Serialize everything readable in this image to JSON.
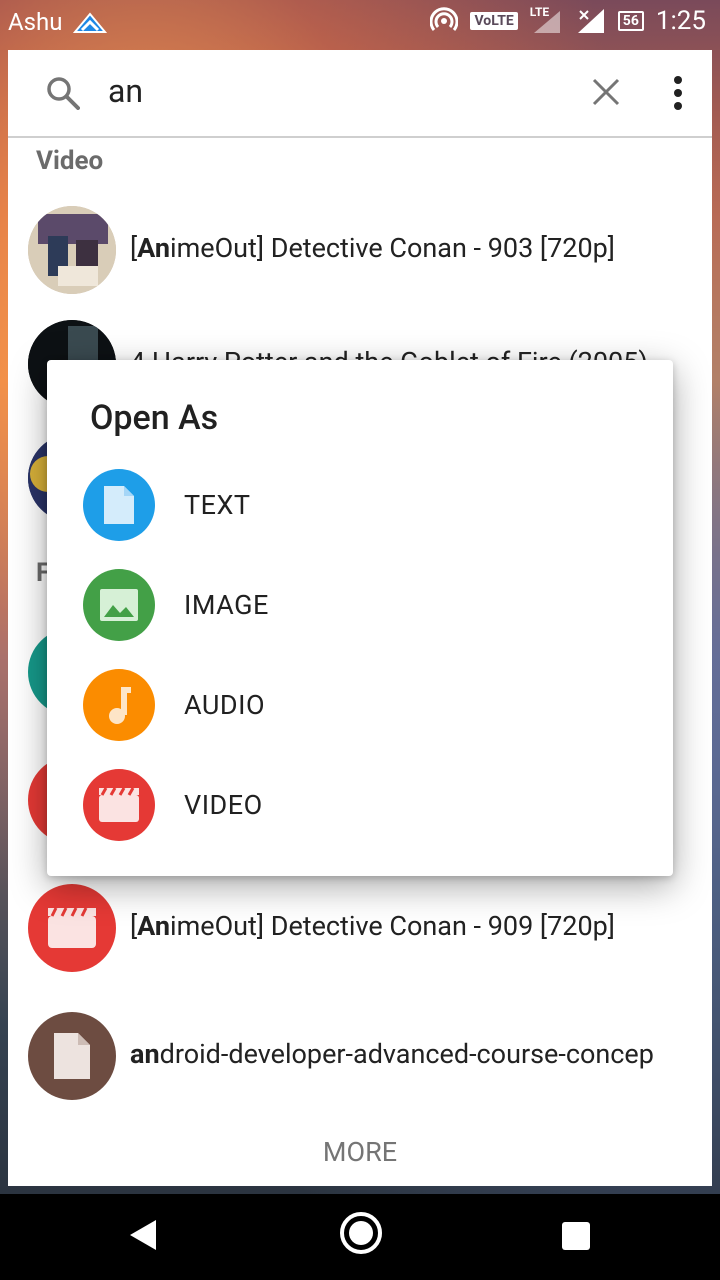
{
  "status_bar": {
    "carrier": "Ashu",
    "volte": "VoLTE",
    "lte": "LTE",
    "battery": "56",
    "time": "1:25"
  },
  "search": {
    "query": "an"
  },
  "sections": {
    "video_title": "Video",
    "files_title_partial": "F"
  },
  "rows": [
    {
      "prefix": "[",
      "bold": "An",
      "rest": "imeOut] Detective Conan - 903 [720p]"
    },
    {
      "prefix": "",
      "bold": "",
      "rest": "4 Harry Potter and the Goblet of Fire (2005)"
    },
    {
      "prefix": "[",
      "bold": "An",
      "rest": "imeOut] Detective Conan - 909 [720p]"
    },
    {
      "prefix": "",
      "bold": "an",
      "rest": "droid-developer-advanced-course-concep"
    }
  ],
  "more_label": "MORE",
  "dialog": {
    "title": "Open As",
    "options": [
      {
        "label": "TEXT",
        "color": "#1e9ee8"
      },
      {
        "label": "IMAGE",
        "color": "#43a047"
      },
      {
        "label": "AUDIO",
        "color": "#fb8c00"
      },
      {
        "label": "VIDEO",
        "color": "#e53935"
      }
    ]
  },
  "colors": {
    "video_red": "#e53935",
    "doc_brown": "#6d4c41",
    "teal": "#16998a"
  }
}
